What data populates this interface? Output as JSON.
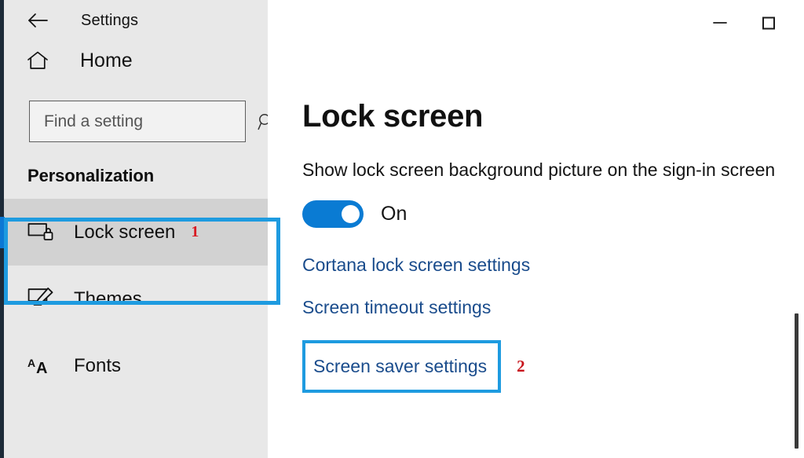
{
  "window": {
    "title": "Settings",
    "back_icon": "back-arrow-icon",
    "minimize_label": "—",
    "maximize_label": "□"
  },
  "sidebar": {
    "home": {
      "label": "Home",
      "icon": "home-icon"
    },
    "search": {
      "value": "",
      "placeholder": "Find a setting",
      "icon": "search-icon"
    },
    "group_header": "Personalization",
    "items": [
      {
        "label": "Lock screen",
        "icon": "monitor-lock-icon",
        "selected": true,
        "badge": "1"
      },
      {
        "label": "Themes",
        "icon": "monitor-brush-icon",
        "selected": false,
        "badge": ""
      },
      {
        "label": "Fonts",
        "icon": "font-aa-icon",
        "selected": false,
        "badge": ""
      }
    ]
  },
  "main": {
    "page_title": "Lock screen",
    "setting_label": "Show lock screen background picture on the sign-in screen",
    "toggle": {
      "state": "On",
      "checked": true
    },
    "links": [
      {
        "label": "Cortana lock screen settings",
        "highlighted": false,
        "badge": ""
      },
      {
        "label": "Screen timeout settings",
        "highlighted": false,
        "badge": ""
      },
      {
        "label": "Screen saver settings",
        "highlighted": true,
        "badge": "2"
      }
    ]
  },
  "colors": {
    "accent_blue": "#0c78d4",
    "annotation_blue": "#1e9be0",
    "annotation_red": "#d81b23",
    "link_blue": "#1a4c8c",
    "sidebar_bg": "#e8e8e8",
    "selected_bg": "#d2d2d2"
  }
}
